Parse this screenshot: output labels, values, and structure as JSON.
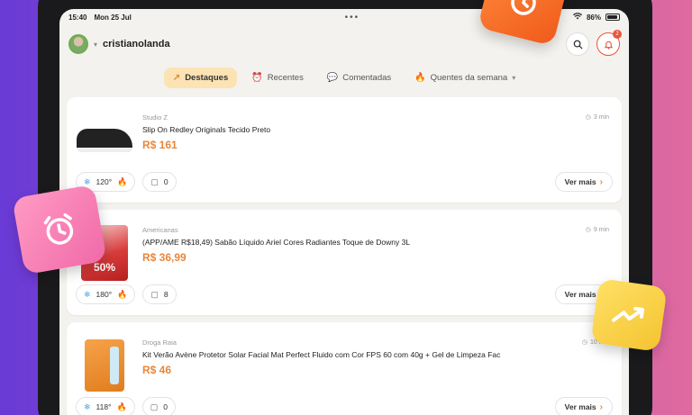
{
  "status": {
    "time": "15:40",
    "date": "Mon 25 Jul",
    "battery": "86%"
  },
  "header": {
    "username": "cristianolanda",
    "notifications_count": "2"
  },
  "tabs": [
    {
      "label": "Destaques",
      "active": true
    },
    {
      "label": "Recentes",
      "active": false
    },
    {
      "label": "Comentadas",
      "active": false
    },
    {
      "label": "Quentes da semana",
      "active": false
    }
  ],
  "deals": [
    {
      "store": "Studio Z",
      "title": "Slip On Redley Originals Tecido Preto",
      "price": "R$ 161",
      "time": "3 min",
      "temperature": "120°",
      "comments": "0",
      "more": "Ver mais"
    },
    {
      "store": "Americanas",
      "title": "(APP/AME R$18,49) Sabão Líquido Ariel Cores Radiantes Toque de Downy 3L",
      "price": "R$ 36,99",
      "time": "9 min",
      "temperature": "180°",
      "comments": "8",
      "more": "Ver mais"
    },
    {
      "store": "Droga Raia",
      "title": "Kit Verão Avène Protetor Solar Facial Mat Perfect Fluido com Cor FPS 60 com 40g + Gel de Limpeza Fac",
      "price": "R$ 46",
      "time": "10 min",
      "temperature": "118°",
      "comments": "0",
      "more": "Ver mais"
    }
  ],
  "colors": {
    "accent": "#e8863b",
    "active_tab_bg": "#fbe3b3",
    "screen_bg": "#f4f2ee"
  }
}
